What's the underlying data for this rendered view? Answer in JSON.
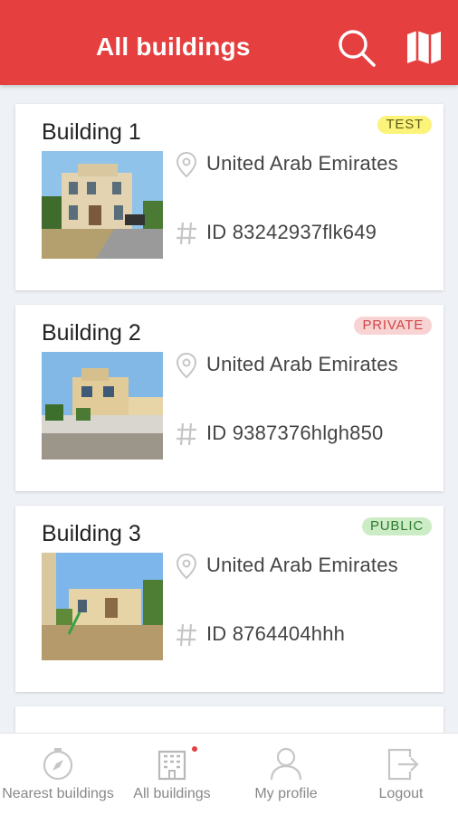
{
  "header": {
    "title": "All buildings",
    "search_icon": "search-icon",
    "map_icon": "map-icon",
    "background": "#e53f3f"
  },
  "buildings": [
    {
      "name": "Building 1",
      "tag": "TEST",
      "tag_bg": "#fbf37a",
      "tag_color": "#5d5a1b",
      "location": "United Arab Emirates",
      "id_text": "ID 83242937flk649"
    },
    {
      "name": "Building 2",
      "tag": "PRIVATE",
      "tag_bg": "#f8d3d3",
      "tag_color": "#d04545",
      "location": "United Arab Emirates",
      "id_text": "ID 9387376hlgh850"
    },
    {
      "name": "Building 3",
      "tag": "PUBLIC",
      "tag_bg": "#ccecc6",
      "tag_color": "#2f7c2f",
      "location": "United Arab Emirates",
      "id_text": "ID 8764404hhh"
    }
  ],
  "bottom_nav": {
    "nearest": "Nearest buildings",
    "all": "All buildings",
    "profile": "My profile",
    "logout": "Logout",
    "notification_dot_color": "#e53f3f"
  }
}
